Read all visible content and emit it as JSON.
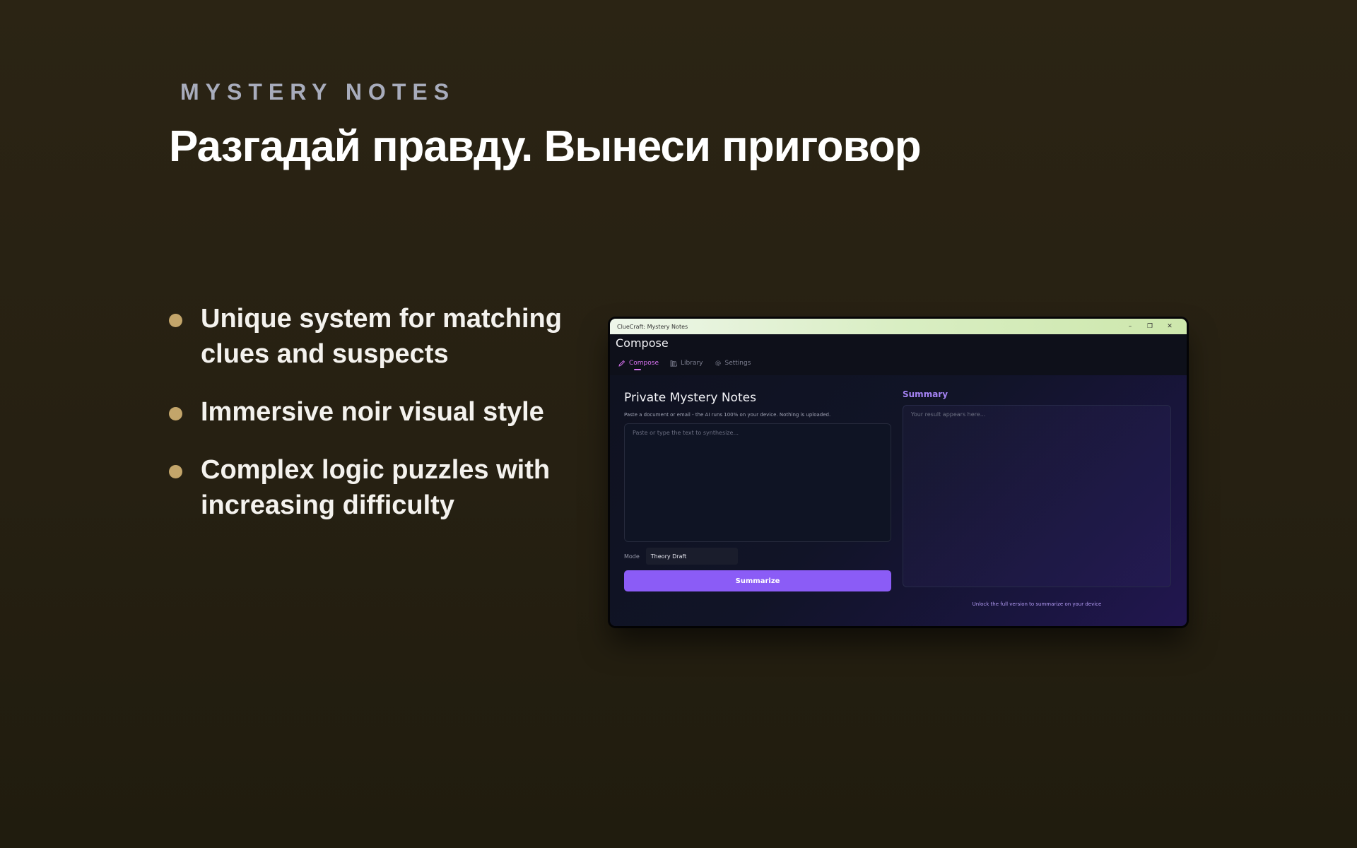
{
  "hero": {
    "eyebrow": "MYSTERY NOTES",
    "headline": "Разгадай правду. Вынеси приговор"
  },
  "features": [
    "Unique system for matching clues and suspects",
    "Immersive noir visual style",
    "Complex logic puzzles with increasing difficulty"
  ],
  "colors": {
    "background": "#2b2414",
    "bullet": "#c3a56a",
    "accent": "#8b5cf6",
    "tab_active": "#d772f0",
    "summary_title": "#a583f4"
  },
  "app": {
    "window_title": "ClueCraft: Mystery Notes",
    "window_controls": {
      "minimize": "–",
      "restore": "❐",
      "close": "✕"
    },
    "page_title": "Compose",
    "tabs": [
      {
        "label": "Compose",
        "icon": "pencil-icon",
        "active": true
      },
      {
        "label": "Library",
        "icon": "library-icon",
        "active": false
      },
      {
        "label": "Settings",
        "icon": "gear-icon",
        "active": false
      }
    ],
    "compose": {
      "title": "Private Mystery Notes",
      "description": "Paste a document or email - the AI runs 100% on your device. Nothing is uploaded.",
      "input_placeholder": "Paste or type the text to synthesize...",
      "mode_label": "Mode",
      "mode_value": "Theory Draft",
      "submit_label": "Summarize"
    },
    "summary": {
      "title": "Summary",
      "placeholder": "Your result appears here...",
      "unlock_text": "Unlock the full version to summarize on your device"
    }
  }
}
